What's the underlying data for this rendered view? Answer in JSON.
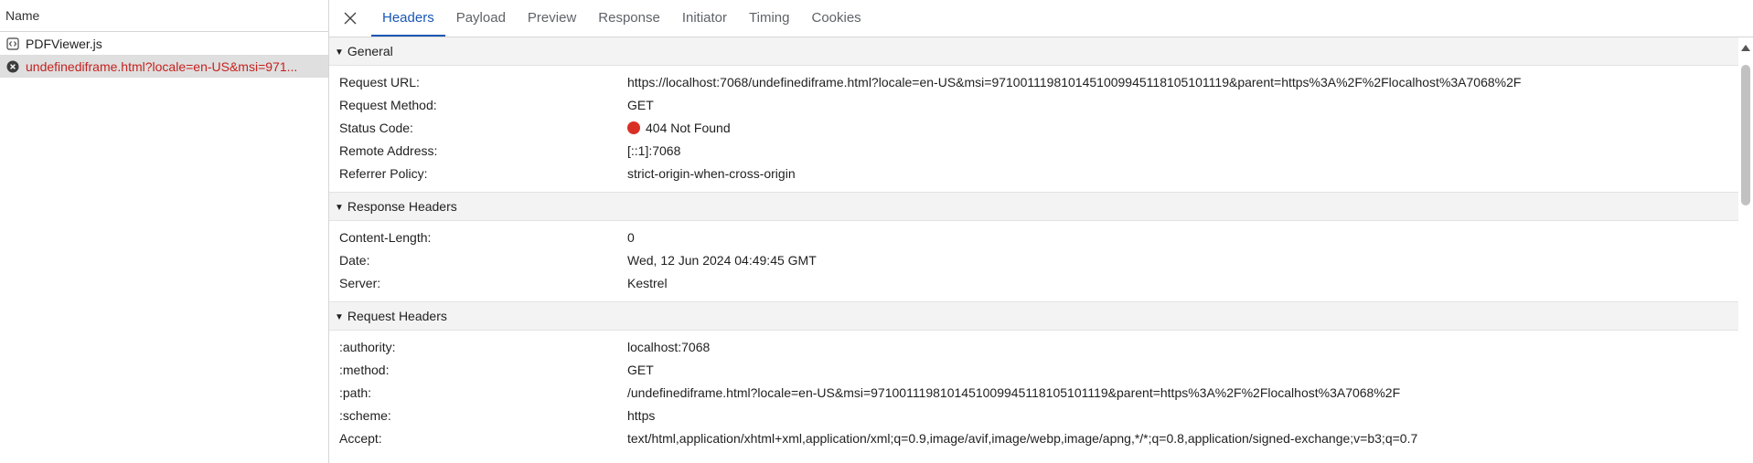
{
  "request_list": {
    "header": "Name",
    "items": [
      {
        "name": "PDFViewer.js",
        "icon": "script-file-icon",
        "status": "ok"
      },
      {
        "name": "undefinediframe.html?locale=en-US&msi=971...",
        "icon": "error-circle-icon",
        "status": "error"
      }
    ]
  },
  "tabs": [
    "Headers",
    "Payload",
    "Preview",
    "Response",
    "Initiator",
    "Timing",
    "Cookies"
  ],
  "active_tab": "Headers",
  "general": {
    "title": "General",
    "rows": [
      {
        "key": "Request URL:",
        "value": "https://localhost:7068/undefinediframe.html?locale=en-US&msi=9710011198101451009945118105101119&parent=https%3A%2F%2Flocalhost%3A7068%2F"
      },
      {
        "key": "Request Method:",
        "value": "GET"
      },
      {
        "key": "Status Code:",
        "value": "404 Not Found"
      },
      {
        "key": "Remote Address:",
        "value": "[::1]:7068"
      },
      {
        "key": "Referrer Policy:",
        "value": "strict-origin-when-cross-origin"
      }
    ]
  },
  "response_headers": {
    "title": "Response Headers",
    "rows": [
      {
        "key": "Content-Length:",
        "value": "0"
      },
      {
        "key": "Date:",
        "value": "Wed, 12 Jun 2024 04:49:45 GMT"
      },
      {
        "key": "Server:",
        "value": "Kestrel"
      }
    ]
  },
  "request_headers": {
    "title": "Request Headers",
    "rows": [
      {
        "key": ":authority:",
        "value": "localhost:7068"
      },
      {
        "key": ":method:",
        "value": "GET"
      },
      {
        "key": ":path:",
        "value": "/undefinediframe.html?locale=en-US&msi=9710011198101451009945118105101119&parent=https%3A%2F%2Flocalhost%3A7068%2F"
      },
      {
        "key": ":scheme:",
        "value": "https"
      },
      {
        "key": "Accept:",
        "value": "text/html,application/xhtml+xml,application/xml;q=0.9,image/avif,image/webp,image/apng,*/*;q=0.8,application/signed-exchange;v=b3;q=0.7"
      }
    ]
  },
  "colors": {
    "accent": "#1a56b5",
    "error": "#c5221f",
    "status_error_dot": "#d93025"
  }
}
